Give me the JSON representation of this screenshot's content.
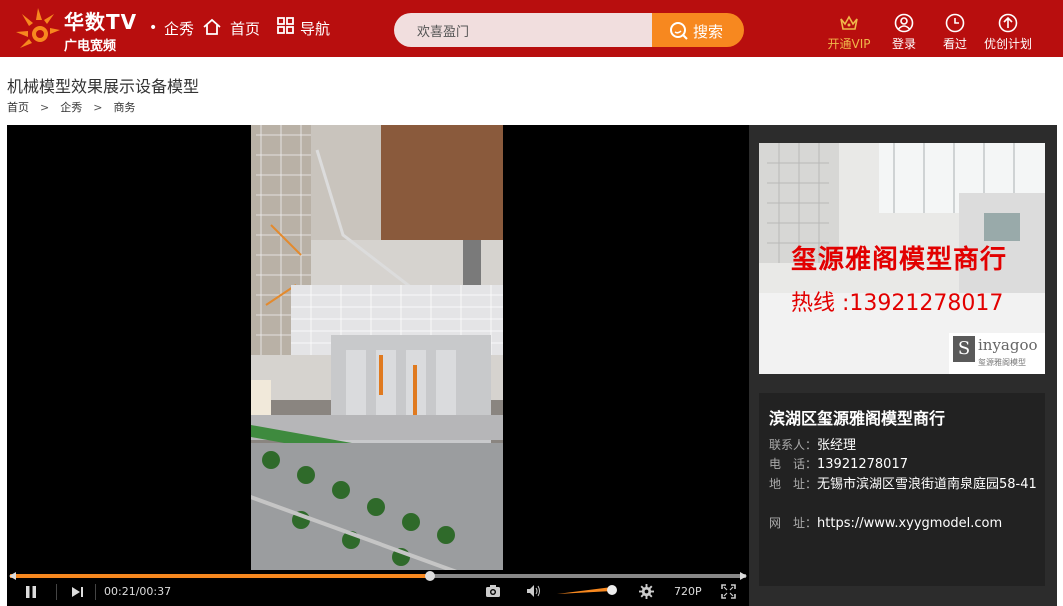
{
  "header": {
    "logo_main": "华数TV",
    "logo_sub": "广电宽频",
    "nav": [
      {
        "label": "企秀",
        "icon": "dot-icon"
      },
      {
        "label": "首页",
        "icon": "home-icon"
      },
      {
        "label": "导航",
        "icon": "grid-icon"
      }
    ],
    "search": {
      "value": "欢喜盈门",
      "button_label": "搜索"
    },
    "right_nav": [
      {
        "label": "开通VIP",
        "icon": "crown-icon",
        "color": "#f0b84a"
      },
      {
        "label": "登录",
        "icon": "user-icon"
      },
      {
        "label": "看过",
        "icon": "clock-icon"
      },
      {
        "label": "优创计划",
        "icon": "upload-icon"
      }
    ]
  },
  "page": {
    "title": "机械模型效果展示设备模型",
    "breadcrumb": [
      "首页",
      "企秀",
      "商务"
    ],
    "breadcrumb_sep": ">"
  },
  "player": {
    "time": "00:21/00:37",
    "progress": 0.57,
    "volume": 0.85,
    "quality": "720P",
    "accent": "#f7881f"
  },
  "ad": {
    "headline": "玺源雅阁模型商行",
    "hotline": "热线 :13921278017",
    "brand": "inyagoo",
    "brand_sub": "玺源雅阁模型"
  },
  "company": {
    "name": "滨湖区玺源雅阁模型商行",
    "contact_label": "联系人：",
    "contact": "张经理",
    "phone_label": "电　话：",
    "phone": "13921278017",
    "address_label": "地　址：",
    "address": "无锡市滨湖区雪浪街道南泉庭园58-41",
    "website_label": "网　址：",
    "website": "https://www.xyygmodel.com"
  }
}
